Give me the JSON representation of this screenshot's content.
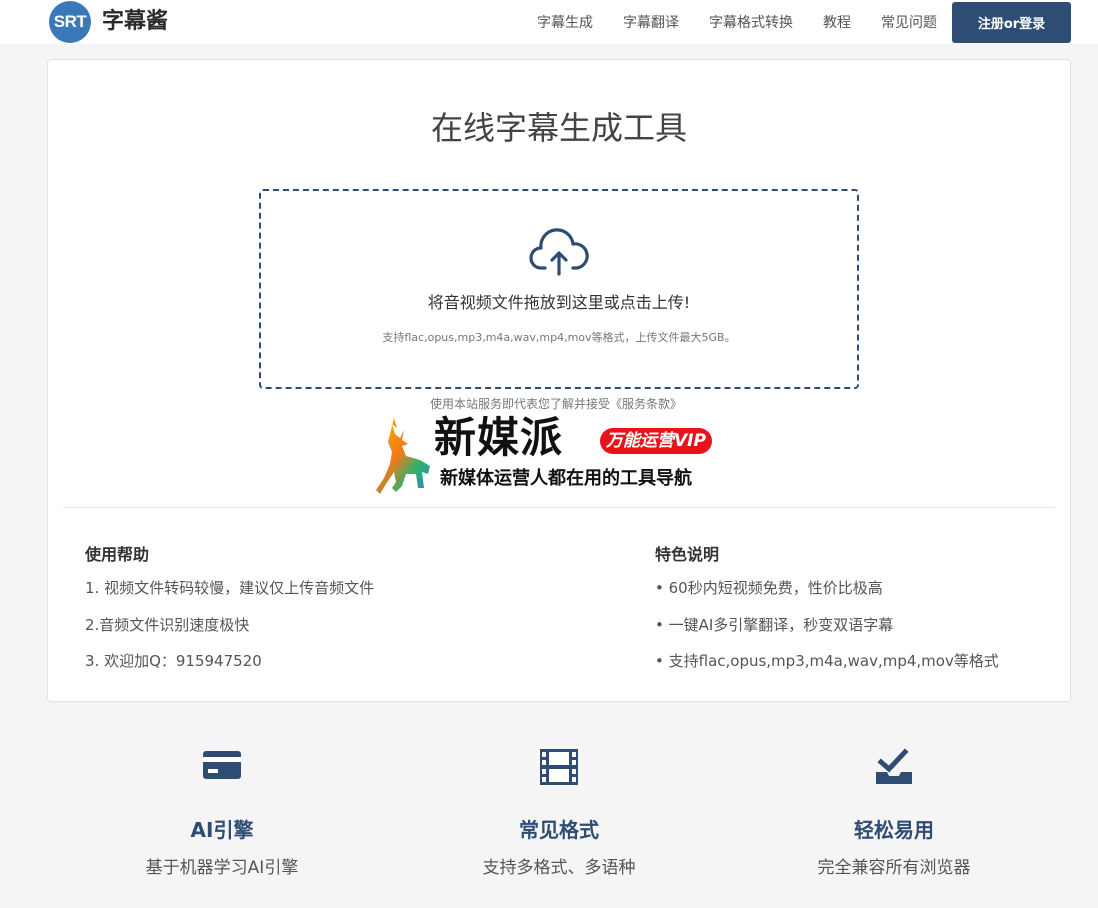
{
  "header": {
    "logo_badge": "SRT",
    "logo_text": "字幕酱",
    "nav": [
      "字幕生成",
      "字幕翻译",
      "字幕格式转换",
      "教程",
      "常见问题"
    ],
    "login_button": "注册or登录"
  },
  "main": {
    "title": "在线字幕生成工具",
    "dropzone": {
      "icon": "cloud-upload-icon",
      "text": "将音视频文件拖放到这里或点击上传!",
      "subtext": "支持flac,opus,mp3,m4a,wav,mp4,mov等格式，上传文件最大5GB。"
    },
    "terms": "使用本站服务即代表您了解并接受《服务条款》",
    "banner": {
      "name": "新媒派",
      "badge": "万能运营VIP",
      "subtitle": "新媒体运营人都在用的工具导航"
    },
    "help": {
      "title": "使用帮助",
      "items": [
        "1. 视频文件转码较慢，建议仅上传音频文件",
        "2.音频文件识别速度极快",
        "3. 欢迎加Q：915947520"
      ]
    },
    "features_info": {
      "title": "特色说明",
      "items": [
        "• 60秒内短视频免费，性价比极高",
        "• 一键AI多引擎翻译，秒变双语字幕",
        "• 支持flac,opus,mp3,m4a,wav,mp4,mov等格式"
      ]
    }
  },
  "features": [
    {
      "icon": "credit-card-icon",
      "title": "AI引擎",
      "desc": "基于机器学习AI引擎"
    },
    {
      "icon": "film-icon",
      "title": "常见格式",
      "desc": "支持多格式、多语种"
    },
    {
      "icon": "check-tray-icon",
      "title": "轻松易用",
      "desc": "完全兼容所有浏览器"
    }
  ],
  "colors": {
    "primary": "#2f4d74",
    "logo": "#3a78b8",
    "badge_red": "#e8141d"
  }
}
